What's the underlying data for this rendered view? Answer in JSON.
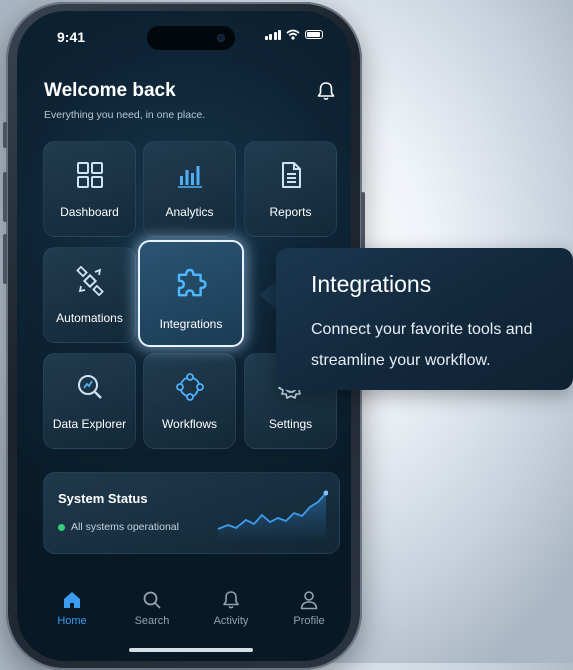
{
  "status_bar": {
    "time": "9:41"
  },
  "header": {
    "title": "Welcome back",
    "subtitle": "Everything you need, in one place."
  },
  "tiles": [
    {
      "label": "Dashboard",
      "icon": "grid-icon"
    },
    {
      "label": "Analytics",
      "icon": "bar-chart-icon"
    },
    {
      "label": "Reports",
      "icon": "document-icon"
    },
    {
      "label": "Automations",
      "icon": "satellite-icon"
    },
    {
      "label": "Integrations",
      "icon": "puzzle-icon",
      "selected": true
    },
    {
      "label": "Data Explorer",
      "icon": "magnifier-chart-icon"
    },
    {
      "label": "Workflows",
      "icon": "workflow-icon"
    },
    {
      "label": "Settings",
      "icon": "gear-icon"
    }
  ],
  "system_status": {
    "title": "System Status",
    "message": "All systems operational",
    "status_color": "#2fd07a"
  },
  "tab_bar": {
    "items": [
      {
        "label": "Home",
        "icon": "home-icon",
        "active": true
      },
      {
        "label": "Search",
        "icon": "search-icon"
      },
      {
        "label": "Activity",
        "icon": "bell-icon"
      },
      {
        "label": "Profile",
        "icon": "person-icon"
      }
    ],
    "accent_color": "#3b9cf0"
  },
  "callout": {
    "title": "Integrations",
    "description": "Connect your favorite tools and streamline your workflow."
  }
}
